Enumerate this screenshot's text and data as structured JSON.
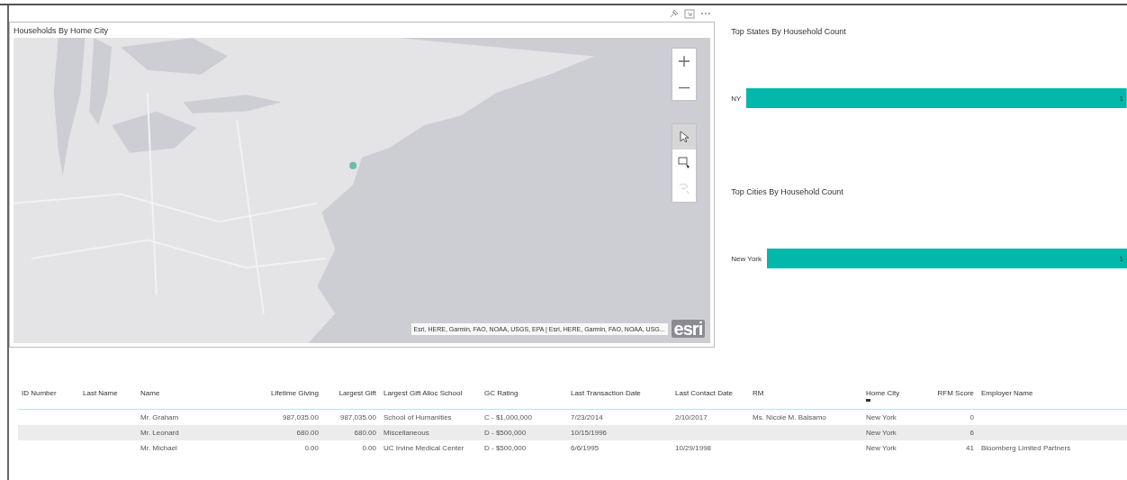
{
  "map_visual": {
    "title": "Households By Home City",
    "attribution": "Esri, HERE, Garmin, FAO, NOAA, USGS, EPA | Esri, HERE, Garmin, FAO, NOAA, USG...",
    "logo": "esri",
    "tools": [
      {
        "kind": "select",
        "selected": true,
        "disabled": false
      },
      {
        "kind": "rect",
        "selected": false,
        "disabled": false
      },
      {
        "kind": "lasso",
        "selected": false,
        "disabled": true
      }
    ]
  },
  "bar_charts": [
    {
      "title": "Top States By Household Count",
      "chart_data": {
        "type": "bar",
        "orientation": "horizontal",
        "categories": [
          "NY"
        ],
        "values": [
          1
        ],
        "data_labels": true
      }
    },
    {
      "title": "Top Cities By Household Count",
      "chart_data": {
        "type": "bar",
        "orientation": "horizontal",
        "categories": [
          "New York"
        ],
        "values": [
          1
        ],
        "data_labels": true
      }
    }
  ],
  "table": {
    "columns": [
      {
        "label": "ID Number",
        "sorted": false
      },
      {
        "label": "Last Name",
        "sorted": false
      },
      {
        "label": "Name",
        "sorted": false
      },
      {
        "label": "Lifetime Giving",
        "sorted": false
      },
      {
        "label": "Largest Gift",
        "sorted": false
      },
      {
        "label": "Largest Gift Alloc School",
        "sorted": false
      },
      {
        "label": "GC Rating",
        "sorted": false
      },
      {
        "label": "Last Transaction Date",
        "sorted": false
      },
      {
        "label": "Last Contact Date",
        "sorted": false
      },
      {
        "label": "RM",
        "sorted": false
      },
      {
        "label": "Home City",
        "sorted": true
      },
      {
        "label": "RFM Score",
        "sorted": false
      },
      {
        "label": "Employer Name",
        "sorted": false
      }
    ],
    "rows": [
      {
        "selected": false,
        "cells": [
          "",
          "",
          "Mr. Graham",
          "987,035.00",
          "987,035.00",
          "School of Humanities",
          "C - $1,000,000",
          "7/23/2014",
          "2/10/2017",
          "Ms. Nicole M. Balsamo",
          "New York",
          "0",
          ""
        ]
      },
      {
        "selected": true,
        "cells": [
          "",
          "",
          "Mr. Leonard",
          "680.00",
          "680.00",
          "Miscellaneous",
          "D - $500,000",
          "10/15/1996",
          "",
          "",
          "New York",
          "6",
          ""
        ]
      },
      {
        "selected": false,
        "cells": [
          "",
          "",
          "Mr. Michael",
          "0.00",
          "0.00",
          "UC Irvine Medical Center",
          "D - $500,000",
          "6/6/1995",
          "10/29/1998",
          "",
          "New York",
          "41",
          "Bloomberg Limited Partners"
        ]
      }
    ]
  }
}
